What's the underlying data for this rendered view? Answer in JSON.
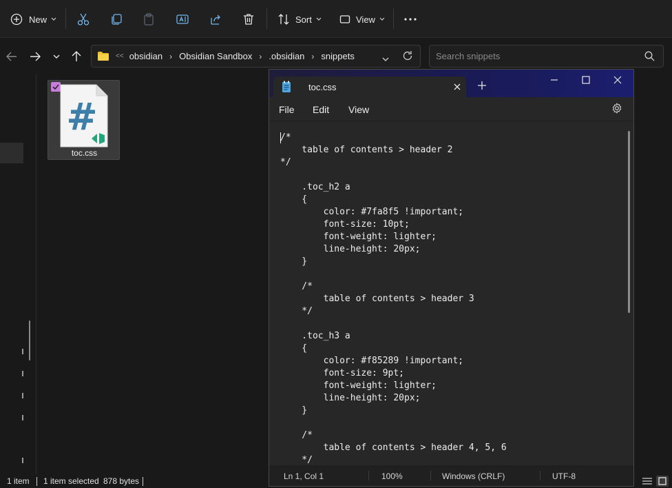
{
  "toolbar": {
    "new_label": "New",
    "sort_label": "Sort",
    "view_label": "View",
    "icons": [
      "plus-circle-icon",
      "scissors-icon",
      "copy-icon",
      "paste-icon",
      "rename-icon",
      "share-icon",
      "delete-icon",
      "sort-icon",
      "view-icon",
      "more-icon"
    ]
  },
  "address": {
    "breadcrumbs": [
      "obsidian",
      "Obsidian Sandbox",
      ".obsidian",
      "snippets"
    ],
    "overflow": "<<",
    "search_placeholder": "Search snippets"
  },
  "files": [
    {
      "name": "toc.css",
      "selected": true,
      "icon": "css-file-icon"
    }
  ],
  "status": {
    "item_count": "1 item",
    "selected": "1 item selected",
    "size": "878 bytes"
  },
  "notepad": {
    "tab_title": "toc.css",
    "menu": [
      "File",
      "Edit",
      "View"
    ],
    "code": "/*\n    table of contents > header 2\n*/\n\n    .toc_h2 a\n    {\n        color: #7fa8f5 !important;\n        font-size: 10pt;\n        font-weight: lighter;\n        line-height: 20px;\n    }\n\n    /*\n        table of contents > header 3\n    */\n\n    .toc_h3 a\n    {\n        color: #f85289 !important;\n        font-size: 9pt;\n        font-weight: lighter;\n        line-height: 20px;\n    }\n\n    /*\n        table of contents > header 4, 5, 6\n    */",
    "status": {
      "position": "Ln 1, Col 1",
      "zoom": "100%",
      "line_ending": "Windows (CRLF)",
      "encoding": "UTF-8"
    }
  },
  "colors": {
    "accent_check": "#c77ed8",
    "file_hash": "#3d7fa8",
    "vscode_badge": "#23a57b"
  }
}
